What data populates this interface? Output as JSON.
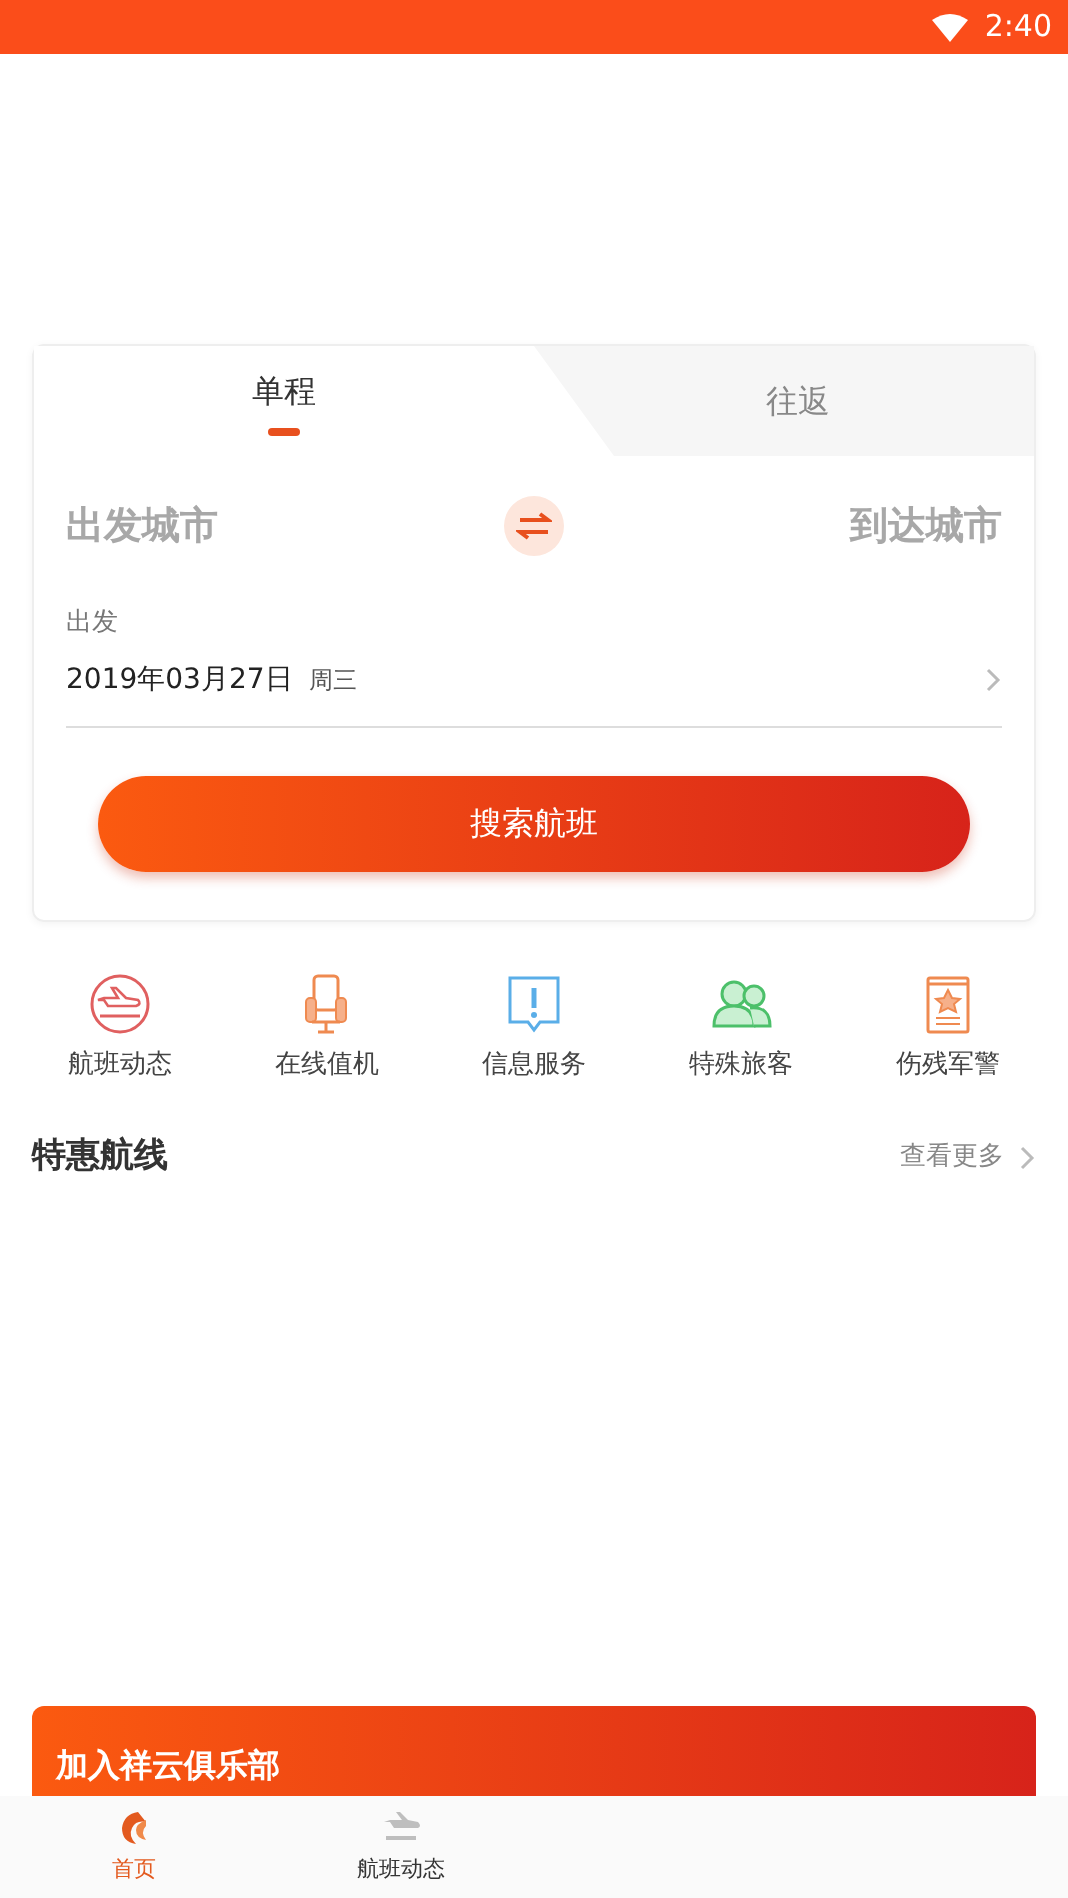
{
  "status_bar": {
    "time": "2:40"
  },
  "trip_tabs": [
    {
      "label": "单程",
      "selected": true
    },
    {
      "label": "往返",
      "selected": false
    }
  ],
  "search": {
    "from_city": "出发城市",
    "to_city": "到达城市",
    "date_label": "出发",
    "date": "2019年03月27日",
    "weekday": "周三",
    "button": "搜索航班"
  },
  "services": [
    {
      "label": "航班动态",
      "kind": "plane"
    },
    {
      "label": "在线值机",
      "kind": "seat"
    },
    {
      "label": "信息服务",
      "kind": "info"
    },
    {
      "label": "特殊旅客",
      "kind": "people"
    },
    {
      "label": "伤残军警",
      "kind": "badge"
    }
  ],
  "deals": {
    "title": "特惠航线",
    "more": "查看更多"
  },
  "banner": {
    "title": "加入祥云俱乐部"
  },
  "bottom_nav": [
    {
      "label": "首页",
      "kind": "home",
      "selected": true
    },
    {
      "label": "航班动态",
      "kind": "plane",
      "selected": false
    }
  ]
}
